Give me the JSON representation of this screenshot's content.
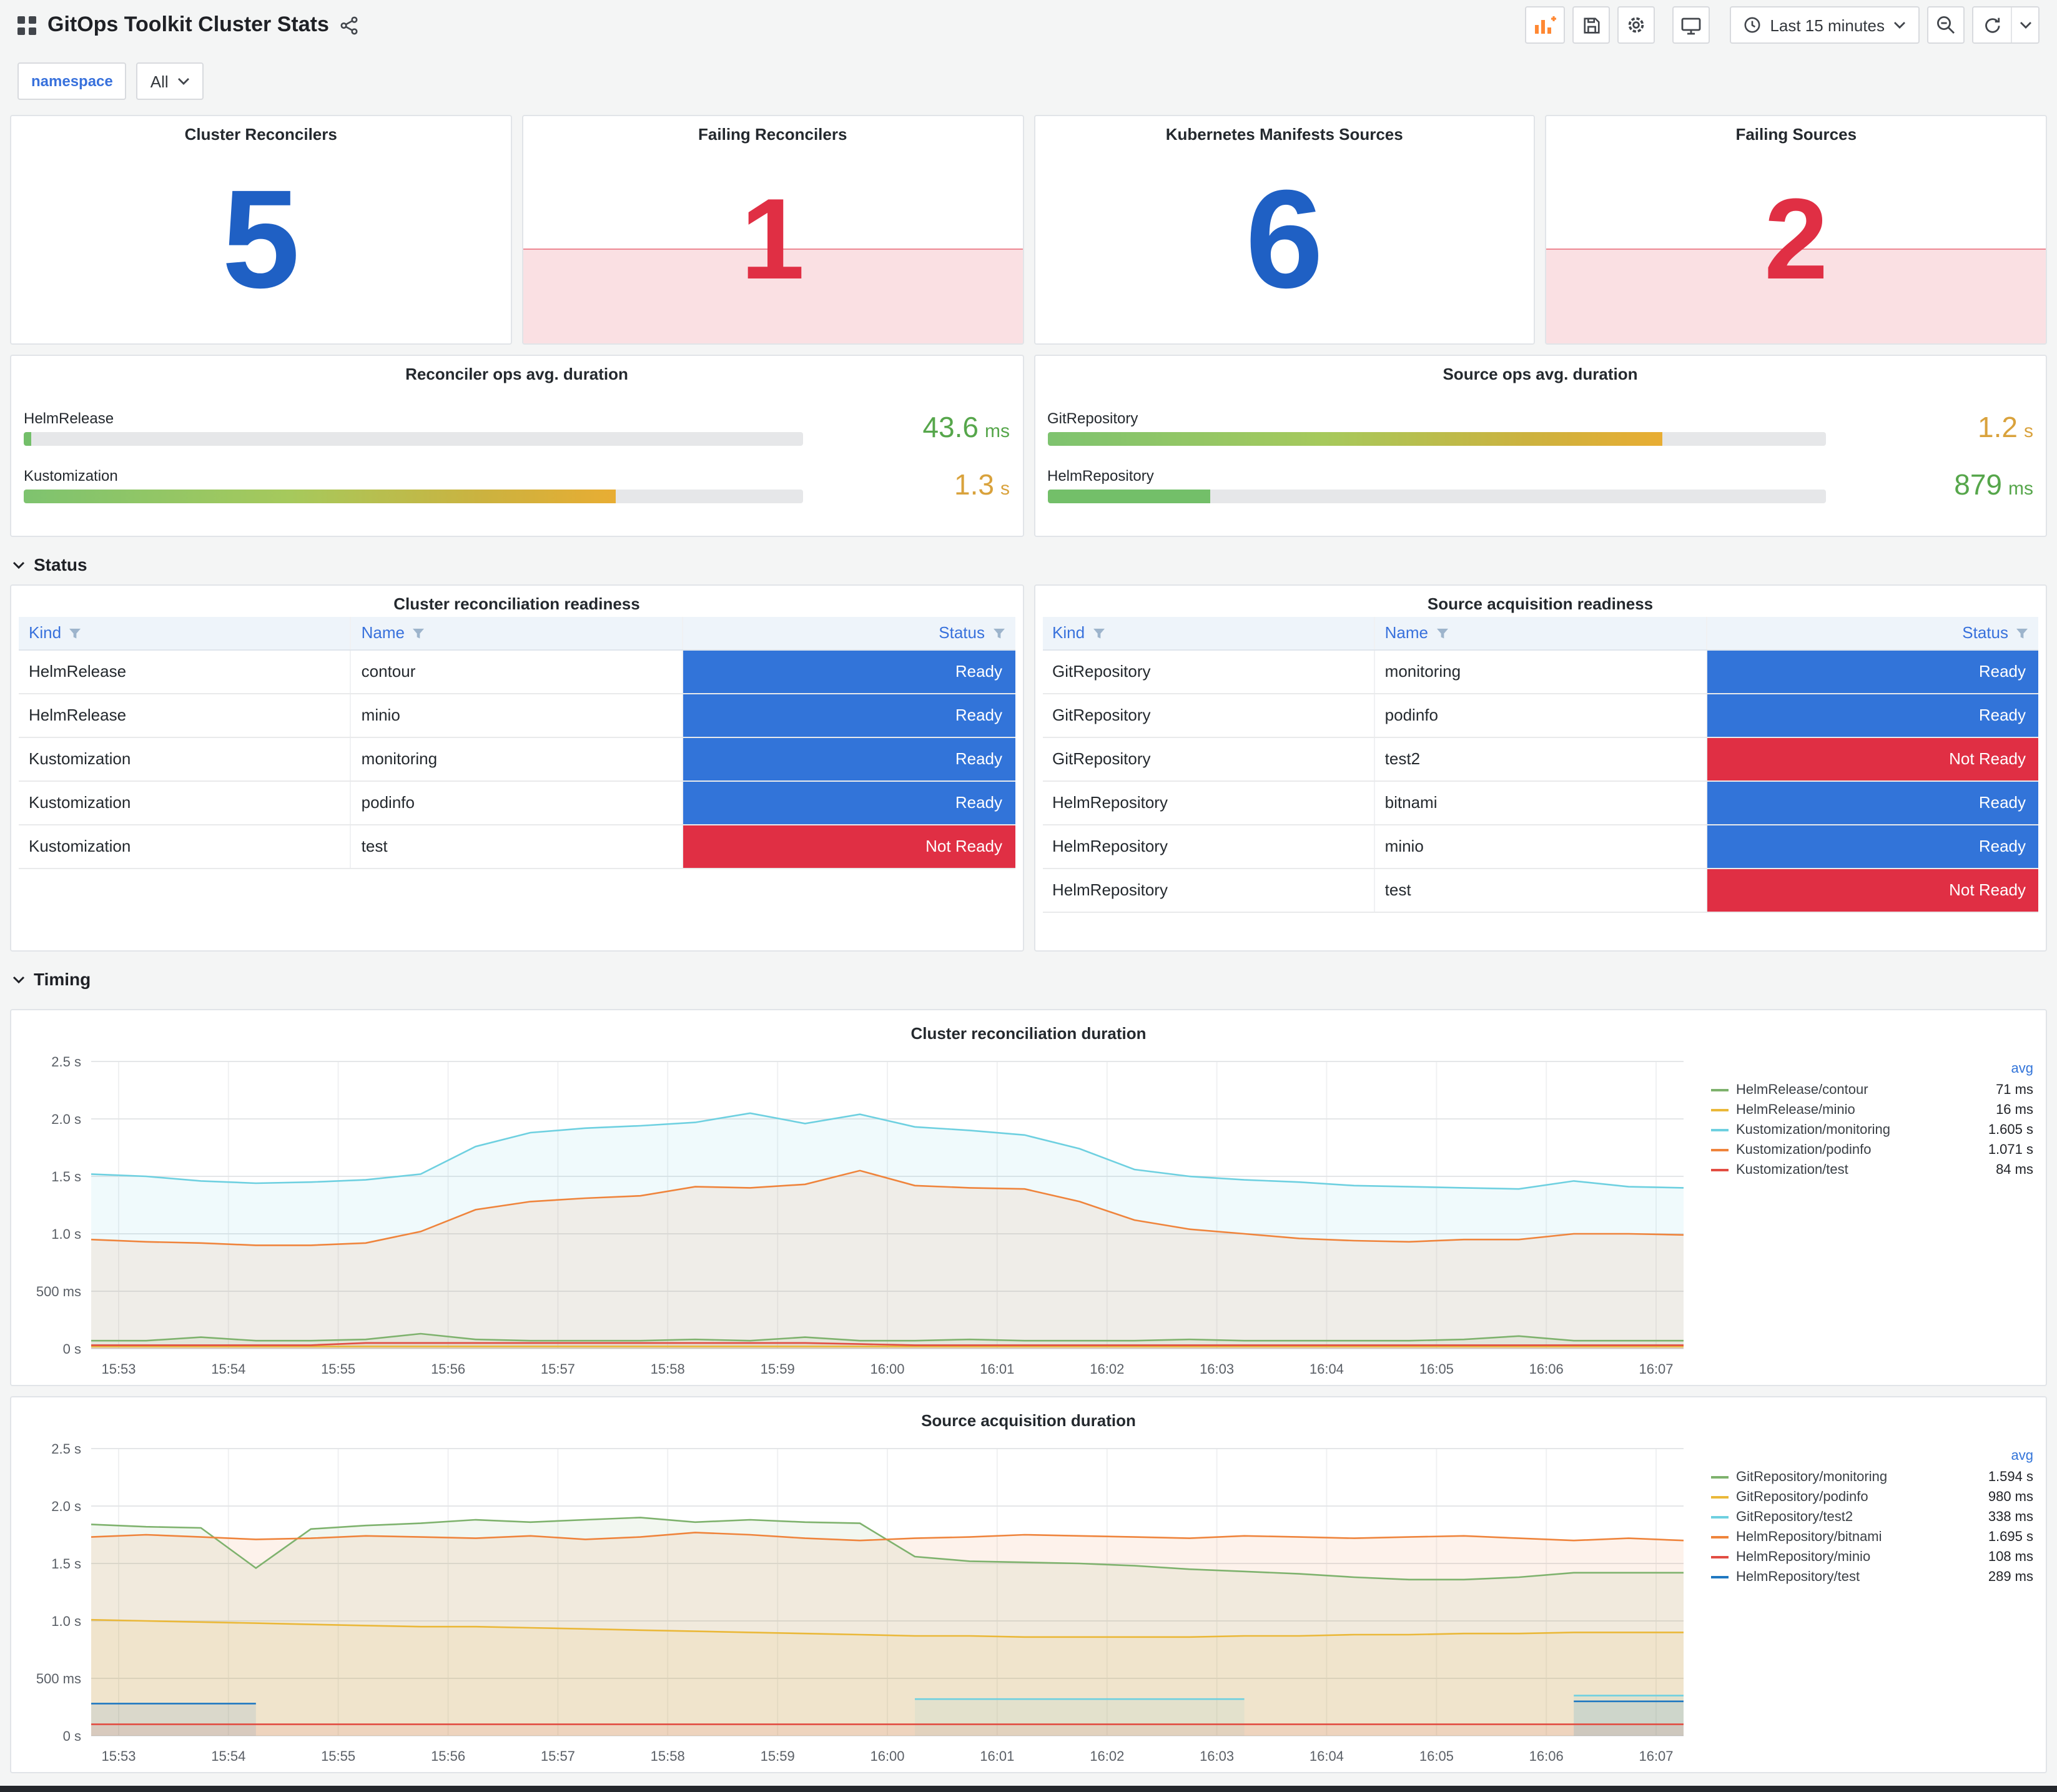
{
  "header": {
    "title": "GitOps Toolkit Cluster Stats",
    "time_range": "Last 15 minutes"
  },
  "filters": {
    "namespace_label": "namespace",
    "namespace_value": "All"
  },
  "sections": {
    "status": "Status",
    "timing": "Timing"
  },
  "colors": {
    "stat_blue": "#1f60c4",
    "stat_red": "#e02f44",
    "table_ready_blue": "#3274d9",
    "table_notready_red": "#e02f44",
    "gauge_green_text": "#56a64b",
    "gauge_yellow_text": "#d9a23c",
    "series_palette": [
      "#7EB26D",
      "#EAB839",
      "#6ED0E0",
      "#EF843C",
      "#E24D42",
      "#1F78C1"
    ]
  },
  "stat_panels": [
    {
      "title": "Cluster Reconcilers",
      "value": "5",
      "state": "ok"
    },
    {
      "title": "Failing Reconcilers",
      "value": "1",
      "state": "alert"
    },
    {
      "title": "Kubernetes Manifests Sources",
      "value": "6",
      "state": "ok"
    },
    {
      "title": "Failing Sources",
      "value": "2",
      "state": "alert"
    }
  ],
  "gauge_panels": [
    {
      "title": "Reconciler ops avg. duration",
      "rows": [
        {
          "label": "HelmRelease",
          "value": "43.6",
          "unit": "ms",
          "percent": 1,
          "level": "green"
        },
        {
          "label": "Kustomization",
          "value": "1.3",
          "unit": "s",
          "percent": 76,
          "level": "yellow"
        }
      ]
    },
    {
      "title": "Source ops avg. duration",
      "rows": [
        {
          "label": "GitRepository",
          "value": "1.2",
          "unit": "s",
          "percent": 79,
          "level": "yellow"
        },
        {
          "label": "HelmRepository",
          "value": "879",
          "unit": "ms",
          "percent": 21,
          "level": "green"
        }
      ]
    }
  ],
  "tables": [
    {
      "title": "Cluster reconciliation readiness",
      "columns": [
        "Kind",
        "Name",
        "Status"
      ],
      "rows": [
        [
          "HelmRelease",
          "contour",
          "Ready"
        ],
        [
          "HelmRelease",
          "minio",
          "Ready"
        ],
        [
          "Kustomization",
          "monitoring",
          "Ready"
        ],
        [
          "Kustomization",
          "podinfo",
          "Ready"
        ],
        [
          "Kustomization",
          "test",
          "Not Ready"
        ]
      ]
    },
    {
      "title": "Source acquisition readiness",
      "columns": [
        "Kind",
        "Name",
        "Status"
      ],
      "rows": [
        [
          "GitRepository",
          "monitoring",
          "Ready"
        ],
        [
          "GitRepository",
          "podinfo",
          "Ready"
        ],
        [
          "GitRepository",
          "test2",
          "Not Ready"
        ],
        [
          "HelmRepository",
          "bitnami",
          "Ready"
        ],
        [
          "HelmRepository",
          "minio",
          "Ready"
        ],
        [
          "HelmRepository",
          "test",
          "Not Ready"
        ]
      ]
    }
  ],
  "chart_data": [
    {
      "type": "line",
      "title": "Cluster reconciliation duration",
      "legend_header": "avg",
      "y_max": 2.5,
      "y_ticks": [
        [
          0,
          "0 s"
        ],
        [
          0.5,
          "500 ms"
        ],
        [
          1,
          "1.0 s"
        ],
        [
          1.5,
          "1.5 s"
        ],
        [
          2,
          "2.0 s"
        ],
        [
          2.5,
          "2.5 s"
        ]
      ],
      "x_ticks": [
        "15:53",
        "15:54",
        "15:55",
        "15:56",
        "15:57",
        "15:58",
        "15:59",
        "16:00",
        "16:01",
        "16:02",
        "16:03",
        "16:04",
        "16:05",
        "16:06",
        "16:07"
      ],
      "x_tick_start_index": 0.5,
      "x_tick_step": 2,
      "series": [
        {
          "name": "HelmRelease/contour",
          "color": "#7EB26D",
          "avg": "71 ms",
          "values": [
            0.07,
            0.07,
            0.1,
            0.07,
            0.07,
            0.08,
            0.13,
            0.08,
            0.07,
            0.07,
            0.07,
            0.08,
            0.07,
            0.1,
            0.07,
            0.07,
            0.08,
            0.07,
            0.07,
            0.07,
            0.08,
            0.07,
            0.07,
            0.07,
            0.07,
            0.08,
            0.11,
            0.07,
            0.07,
            0.07
          ]
        },
        {
          "name": "HelmRelease/minio",
          "color": "#EAB839",
          "avg": "16 ms",
          "values": [
            0.02,
            0.02,
            0.02,
            0.02,
            0.02,
            0.02,
            0.02,
            0.02,
            0.02,
            0.02,
            0.02,
            0.02,
            0.02,
            0.02,
            0.02,
            0.02,
            0.02,
            0.02,
            0.02,
            0.02,
            0.02,
            0.02,
            0.02,
            0.02,
            0.02,
            0.02,
            0.02,
            0.02,
            0.02,
            0.02
          ]
        },
        {
          "name": "Kustomization/monitoring",
          "color": "#6ED0E0",
          "avg": "1.605 s",
          "values": [
            1.52,
            1.5,
            1.46,
            1.44,
            1.45,
            1.47,
            1.52,
            1.76,
            1.88,
            1.92,
            1.94,
            1.97,
            2.05,
            1.96,
            2.04,
            1.93,
            1.9,
            1.86,
            1.74,
            1.56,
            1.5,
            1.47,
            1.45,
            1.42,
            1.41,
            1.4,
            1.39,
            1.46,
            1.41,
            1.4
          ]
        },
        {
          "name": "Kustomization/podinfo",
          "color": "#EF843C",
          "avg": "1.071 s",
          "values": [
            0.95,
            0.93,
            0.92,
            0.9,
            0.9,
            0.92,
            1.02,
            1.21,
            1.28,
            1.31,
            1.33,
            1.41,
            1.4,
            1.43,
            1.55,
            1.42,
            1.4,
            1.39,
            1.28,
            1.12,
            1.04,
            1.0,
            0.96,
            0.94,
            0.93,
            0.95,
            0.95,
            1.0,
            1.0,
            0.99
          ]
        },
        {
          "name": "Kustomization/test",
          "color": "#E24D42",
          "avg": "84 ms",
          "values": [
            0.03,
            0.03,
            0.03,
            0.03,
            0.03,
            0.05,
            0.05,
            0.05,
            0.05,
            0.05,
            0.05,
            0.05,
            0.05,
            0.05,
            0.04,
            0.03,
            0.03,
            0.03,
            0.03,
            0.03,
            0.03,
            0.03,
            0.03,
            0.03,
            0.03,
            0.03,
            0.03,
            0.03,
            0.03,
            0.03
          ]
        }
      ]
    },
    {
      "type": "line",
      "title": "Source acquisition duration",
      "legend_header": "avg",
      "y_max": 2.5,
      "y_ticks": [
        [
          0,
          "0 s"
        ],
        [
          0.5,
          "500 ms"
        ],
        [
          1,
          "1.0 s"
        ],
        [
          1.5,
          "1.5 s"
        ],
        [
          2,
          "2.0 s"
        ],
        [
          2.5,
          "2.5 s"
        ]
      ],
      "x_ticks": [
        "15:53",
        "15:54",
        "15:55",
        "15:56",
        "15:57",
        "15:58",
        "15:59",
        "16:00",
        "16:01",
        "16:02",
        "16:03",
        "16:04",
        "16:05",
        "16:06",
        "16:07"
      ],
      "x_tick_start_index": 0.5,
      "x_tick_step": 2,
      "series": [
        {
          "name": "GitRepository/monitoring",
          "color": "#7EB26D",
          "avg": "1.594 s",
          "values": [
            1.84,
            1.82,
            1.81,
            1.46,
            1.8,
            1.83,
            1.85,
            1.88,
            1.86,
            1.88,
            1.9,
            1.86,
            1.88,
            1.86,
            1.85,
            1.56,
            1.52,
            1.51,
            1.5,
            1.48,
            1.45,
            1.43,
            1.41,
            1.38,
            1.36,
            1.36,
            1.38,
            1.42,
            1.42,
            1.42
          ]
        },
        {
          "name": "GitRepository/podinfo",
          "color": "#EAB839",
          "avg": "980 ms",
          "values": [
            1.01,
            1.0,
            0.99,
            0.98,
            0.97,
            0.96,
            0.95,
            0.95,
            0.94,
            0.93,
            0.92,
            0.91,
            0.9,
            0.89,
            0.88,
            0.87,
            0.87,
            0.86,
            0.86,
            0.86,
            0.86,
            0.87,
            0.87,
            0.88,
            0.88,
            0.89,
            0.89,
            0.9,
            0.9,
            0.9
          ]
        },
        {
          "name": "GitRepository/test2",
          "color": "#6ED0E0",
          "avg": "338 ms",
          "values": [
            null,
            null,
            null,
            null,
            null,
            null,
            null,
            null,
            null,
            null,
            null,
            null,
            null,
            null,
            null,
            0.32,
            0.32,
            0.32,
            0.32,
            0.32,
            0.32,
            0.32,
            null,
            null,
            null,
            null,
            null,
            0.35,
            0.35,
            0.35
          ]
        },
        {
          "name": "HelmRepository/bitnami",
          "color": "#EF843C",
          "avg": "1.695 s",
          "values": [
            1.73,
            1.75,
            1.73,
            1.71,
            1.72,
            1.74,
            1.73,
            1.72,
            1.74,
            1.71,
            1.73,
            1.77,
            1.75,
            1.72,
            1.7,
            1.72,
            1.73,
            1.75,
            1.74,
            1.73,
            1.72,
            1.74,
            1.73,
            1.72,
            1.73,
            1.74,
            1.72,
            1.7,
            1.72,
            1.7
          ]
        },
        {
          "name": "HelmRepository/minio",
          "color": "#E24D42",
          "avg": "108 ms",
          "values": [
            0.1,
            0.1,
            0.1,
            0.1,
            0.1,
            0.1,
            0.1,
            0.1,
            0.1,
            0.1,
            0.1,
            0.1,
            0.1,
            0.1,
            0.1,
            0.1,
            0.1,
            0.1,
            0.1,
            0.1,
            0.1,
            0.1,
            0.1,
            0.1,
            0.1,
            0.1,
            0.1,
            0.1,
            0.1,
            0.1
          ]
        },
        {
          "name": "HelmRepository/test",
          "color": "#1F78C1",
          "avg": "289 ms",
          "values": [
            0.28,
            0.28,
            0.28,
            0.28,
            null,
            null,
            null,
            null,
            null,
            null,
            null,
            null,
            null,
            null,
            null,
            null,
            null,
            null,
            null,
            null,
            null,
            null,
            null,
            null,
            null,
            null,
            null,
            0.3,
            0.3,
            0.3
          ]
        }
      ]
    }
  ]
}
